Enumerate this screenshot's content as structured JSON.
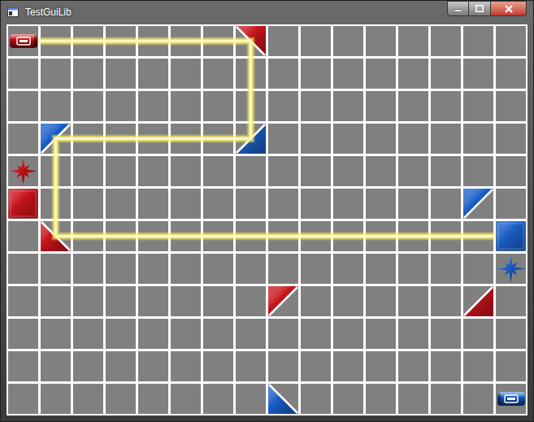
{
  "window": {
    "title": "TestGuiLib"
  },
  "board": {
    "rows": 12,
    "cols": 16
  },
  "pieces": [
    {
      "kind": "emitter",
      "color": "#c8141c",
      "row": 0,
      "col": 0,
      "facing": "right"
    },
    {
      "kind": "mirror",
      "color": "#c8141c",
      "row": 0,
      "col": 7,
      "corner": "top-right"
    },
    {
      "kind": "mirror",
      "color": "#1a5fc8",
      "row": 3,
      "col": 7,
      "corner": "bottom-right"
    },
    {
      "kind": "mirror",
      "color": "#1a5fc8",
      "row": 3,
      "col": 1,
      "corner": "top-left"
    },
    {
      "kind": "star",
      "color": "#c8141c",
      "row": 4,
      "col": 0
    },
    {
      "kind": "block",
      "color": "#c8141c",
      "row": 5,
      "col": 0
    },
    {
      "kind": "mirror",
      "color": "#c8141c",
      "row": 6,
      "col": 1,
      "corner": "bottom-left"
    },
    {
      "kind": "mirror",
      "color": "#1a5fc8",
      "row": 5,
      "col": 14,
      "corner": "top-left"
    },
    {
      "kind": "block",
      "color": "#1a5fc8",
      "row": 6,
      "col": 15
    },
    {
      "kind": "star",
      "color": "#1a5fc8",
      "row": 7,
      "col": 15
    },
    {
      "kind": "mirror",
      "color": "#c8141c",
      "row": 8,
      "col": 8,
      "corner": "top-left"
    },
    {
      "kind": "mirror",
      "color": "#c8141c",
      "row": 8,
      "col": 14,
      "corner": "bottom-right"
    },
    {
      "kind": "mirror",
      "color": "#1a5fc8",
      "row": 11,
      "col": 8,
      "corner": "bottom-left"
    },
    {
      "kind": "emitter",
      "color": "#1a5fc8",
      "row": 11,
      "col": 15,
      "facing": "left"
    }
  ],
  "beam": {
    "color": "#fff36a",
    "points": [
      [
        0.5,
        0
      ],
      [
        7,
        0
      ],
      [
        7,
        3
      ],
      [
        1,
        3
      ],
      [
        1,
        6
      ],
      [
        14.5,
        6
      ]
    ]
  }
}
